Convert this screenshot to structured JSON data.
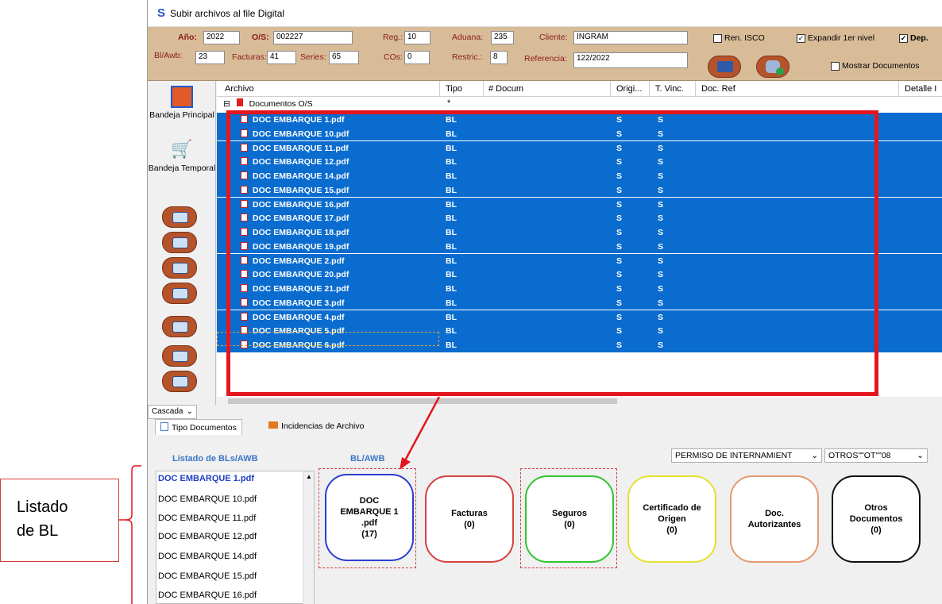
{
  "window": {
    "title": "Subir archivos al file Digital"
  },
  "filters": {
    "anio_label": "Año:",
    "anio": "2022",
    "os_label": "O/S:",
    "os": "002227",
    "reg_label": "Reg.:",
    "reg": "10",
    "aduana_label": "Aduana:",
    "aduana": "235",
    "cliente_label": "Cliente:",
    "cliente": "INGRAM",
    "bl_label": "Bl/Awb:",
    "bl": "23",
    "facturas_label": "Facturas:",
    "facturas": "41",
    "series_label": "Series:",
    "series": "65",
    "cos_label": "COs:",
    "cos": "0",
    "restric_label": "Restric.:",
    "restric": "8",
    "referencia_label": "Referencia:",
    "referencia": "122/2022",
    "ren_isco_label": "Ren. ISCO",
    "expandir_label": "Expandir 1er nivel",
    "dep_label": "Dep.",
    "mostrar_label": "Mostrar Documentos"
  },
  "sidebar": {
    "bandeja_principal": "Bandeja Principal",
    "bandeja_temporal": "Bandeja Temporal",
    "cascada": "Cascada"
  },
  "tree": {
    "columns": [
      "Archivo",
      "Tipo",
      "# Docum",
      "Origi...",
      "T. Vinc.",
      "Doc. Ref",
      "Detalle I"
    ],
    "root_label": "Documentos O/S",
    "root_tipo": "*",
    "rows": [
      {
        "file": "DOC EMBARQUE 1.pdf",
        "tipo": "BL",
        "orig": "S",
        "vinc": "S"
      },
      {
        "file": "DOC EMBARQUE 10.pdf",
        "tipo": "BL",
        "orig": "S",
        "vinc": "S"
      },
      {
        "file": "DOC EMBARQUE 11.pdf",
        "tipo": "BL",
        "orig": "S",
        "vinc": "S"
      },
      {
        "file": "DOC EMBARQUE 12.pdf",
        "tipo": "BL",
        "orig": "S",
        "vinc": "S"
      },
      {
        "file": "DOC EMBARQUE 14.pdf",
        "tipo": "BL",
        "orig": "S",
        "vinc": "S"
      },
      {
        "file": "DOC EMBARQUE 15.pdf",
        "tipo": "BL",
        "orig": "S",
        "vinc": "S"
      },
      {
        "file": "DOC EMBARQUE 16.pdf",
        "tipo": "BL",
        "orig": "S",
        "vinc": "S"
      },
      {
        "file": "DOC EMBARQUE 17.pdf",
        "tipo": "BL",
        "orig": "S",
        "vinc": "S"
      },
      {
        "file": "DOC EMBARQUE 18.pdf",
        "tipo": "BL",
        "orig": "S",
        "vinc": "S"
      },
      {
        "file": "DOC EMBARQUE 19.pdf",
        "tipo": "BL",
        "orig": "S",
        "vinc": "S"
      },
      {
        "file": "DOC EMBARQUE 2.pdf",
        "tipo": "BL",
        "orig": "S",
        "vinc": "S"
      },
      {
        "file": "DOC EMBARQUE 20.pdf",
        "tipo": "BL",
        "orig": "S",
        "vinc": "S"
      },
      {
        "file": "DOC EMBARQUE 21.pdf",
        "tipo": "BL",
        "orig": "S",
        "vinc": "S"
      },
      {
        "file": "DOC EMBARQUE 3.pdf",
        "tipo": "BL",
        "orig": "S",
        "vinc": "S"
      },
      {
        "file": "DOC EMBARQUE 4.pdf",
        "tipo": "BL",
        "orig": "S",
        "vinc": "S"
      },
      {
        "file": "DOC EMBARQUE 5.pdf",
        "tipo": "BL",
        "orig": "S",
        "vinc": "S"
      },
      {
        "file": "DOC EMBARQUE 6.pdf",
        "tipo": "BL",
        "orig": "S",
        "vinc": "S"
      }
    ]
  },
  "tabs": {
    "tipo_documentos": "Tipo Documentos",
    "incidencias": "Incidencias de Archivo"
  },
  "combos": {
    "permiso": "PERMISO DE INTERNAMIENT",
    "otros": "OTROS\"\"OT\"\"08"
  },
  "lower": {
    "listado_header": "Listado de BLs/AWB",
    "bl_header": "BL/AWB",
    "bl_list": [
      "DOC EMBARQUE 1.pdf",
      "DOC EMBARQUE 10.pdf",
      "DOC EMBARQUE 11.pdf",
      "DOC EMBARQUE 12.pdf",
      "DOC EMBARQUE 14.pdf",
      "DOC EMBARQUE 15.pdf",
      "DOC EMBARQUE 16.pdf"
    ]
  },
  "cards": {
    "bl": {
      "l1": "DOC",
      "l2": "EMBARQUE 1",
      "l3": ".pdf",
      "count": "(17)"
    },
    "facturas": {
      "l1": "Facturas",
      "count": "(0)"
    },
    "seguros": {
      "l1": "Seguros",
      "count": "(0)"
    },
    "certificado": {
      "l1": "Certificado de",
      "l2": "Origen",
      "count": "(0)"
    },
    "autorizantes": {
      "l1": "Doc.",
      "l2": "Autorizantes"
    },
    "otros": {
      "l1": "Otros",
      "l2": "Documentos",
      "count": "(0)"
    }
  },
  "callout": {
    "line1": "Listado",
    "line2": "de BL"
  },
  "colors": {
    "selection": "#0a6ccf",
    "annotation": "#e4161d",
    "filters_bg": "#d8bc98"
  }
}
